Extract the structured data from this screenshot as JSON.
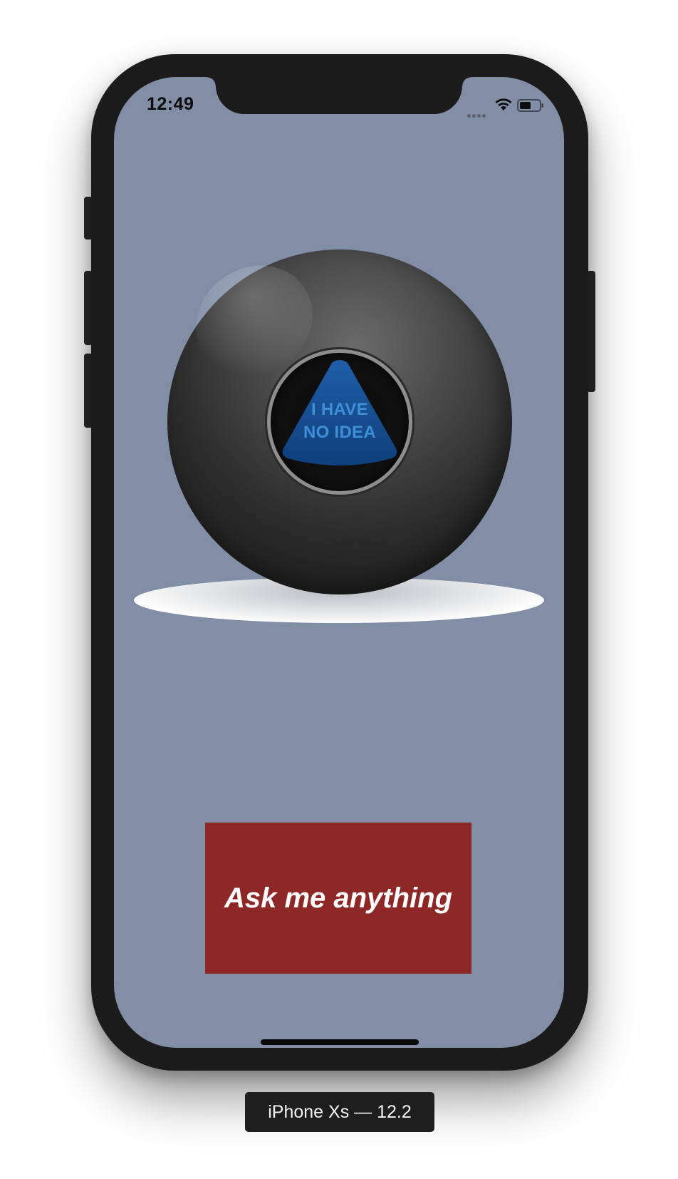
{
  "status_bar": {
    "time": "12:49",
    "icons": [
      "signal-dots-icon",
      "wifi-icon",
      "battery-icon"
    ]
  },
  "magic_ball": {
    "answer_line1": "I HAVE",
    "answer_line2": "NO IDEA"
  },
  "ask_button": {
    "label": "Ask me anything"
  },
  "simulator": {
    "device_label": "iPhone Xs — 12.2"
  },
  "colors": {
    "screen_background": "#818ea6",
    "button_background": "#8e2826",
    "answer_text": "#3f8fd6",
    "device_frame": "#1b1b1b"
  }
}
